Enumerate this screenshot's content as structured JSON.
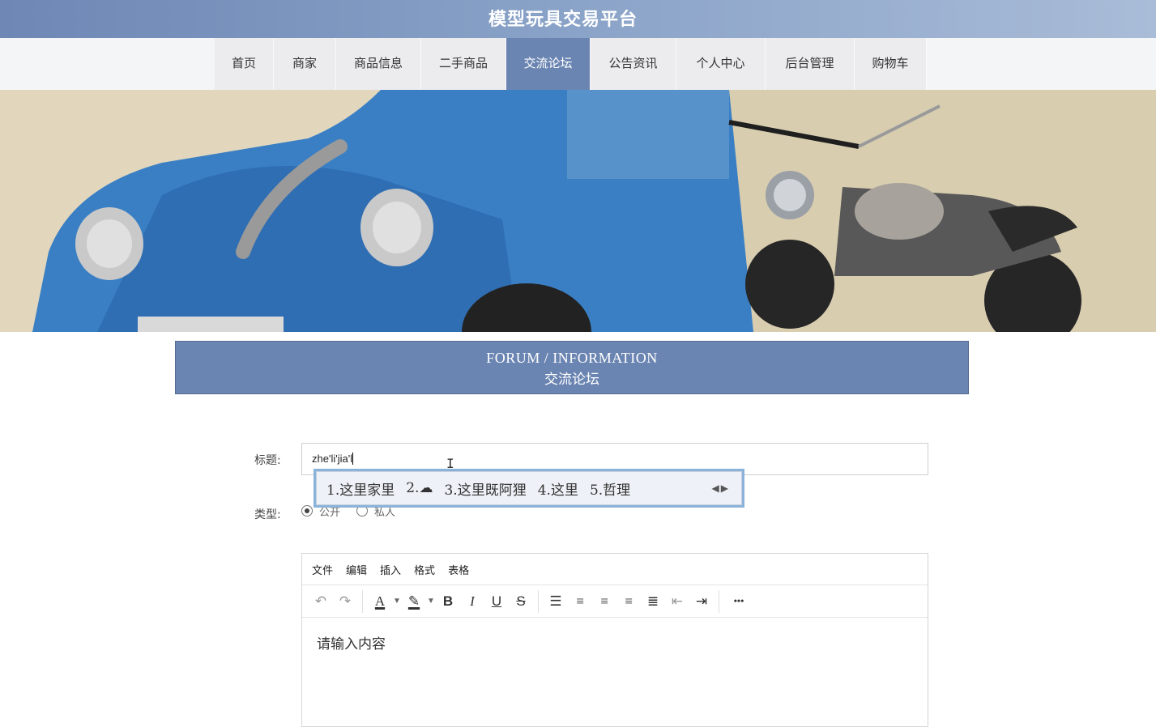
{
  "site": {
    "title": "模型玩具交易平台"
  },
  "nav": {
    "items": [
      {
        "label": "首页",
        "active": false
      },
      {
        "label": "商家",
        "active": false
      },
      {
        "label": "商品信息",
        "active": false
      },
      {
        "label": "二手商品",
        "active": false
      },
      {
        "label": "交流论坛",
        "active": true
      },
      {
        "label": "公告资讯",
        "active": false
      },
      {
        "label": "个人中心",
        "active": false
      },
      {
        "label": "后台管理",
        "active": false
      },
      {
        "label": "购物车",
        "active": false
      }
    ]
  },
  "section": {
    "title_en": "FORUM / INFORMATION",
    "title_cn": "交流论坛"
  },
  "form": {
    "title_label": "标题:",
    "title_value": "zhe'li'jia'l",
    "type_label": "类型:",
    "type_options": [
      {
        "label": "公开",
        "checked": true
      },
      {
        "label": "私人",
        "checked": false
      }
    ]
  },
  "ime": {
    "candidates": [
      "1.这里家里",
      "2.☁",
      "3.这里既阿狸",
      "4.这里",
      "5.哲理"
    ],
    "arrows": "◀▶"
  },
  "editor": {
    "menu": [
      "文件",
      "编辑",
      "插入",
      "格式",
      "表格"
    ],
    "toolbar": [
      {
        "icon": "undo-icon",
        "glyph": "↶"
      },
      {
        "icon": "redo-icon",
        "glyph": "↷"
      },
      {
        "icon": "text-color-icon",
        "glyph": "A"
      },
      {
        "icon": "highlight-icon",
        "glyph": "✎"
      },
      {
        "icon": "bold-icon",
        "glyph": "B"
      },
      {
        "icon": "italic-icon",
        "glyph": "I"
      },
      {
        "icon": "underline-icon",
        "glyph": "U"
      },
      {
        "icon": "strikethrough-icon",
        "glyph": "S"
      },
      {
        "icon": "line-height-icon",
        "glyph": "☰"
      },
      {
        "icon": "align-left-icon",
        "glyph": "≡"
      },
      {
        "icon": "align-center-icon",
        "glyph": "≡"
      },
      {
        "icon": "align-right-icon",
        "glyph": "≡"
      },
      {
        "icon": "align-justify-icon",
        "glyph": "≣"
      },
      {
        "icon": "outdent-icon",
        "glyph": "⇤"
      },
      {
        "icon": "indent-icon",
        "glyph": "⇥"
      },
      {
        "icon": "more-icon",
        "glyph": "•••"
      }
    ],
    "placeholder": "请输入内容"
  },
  "colors": {
    "primary": "#6b85b2",
    "header_gradient_end": "#a9bcd8"
  }
}
